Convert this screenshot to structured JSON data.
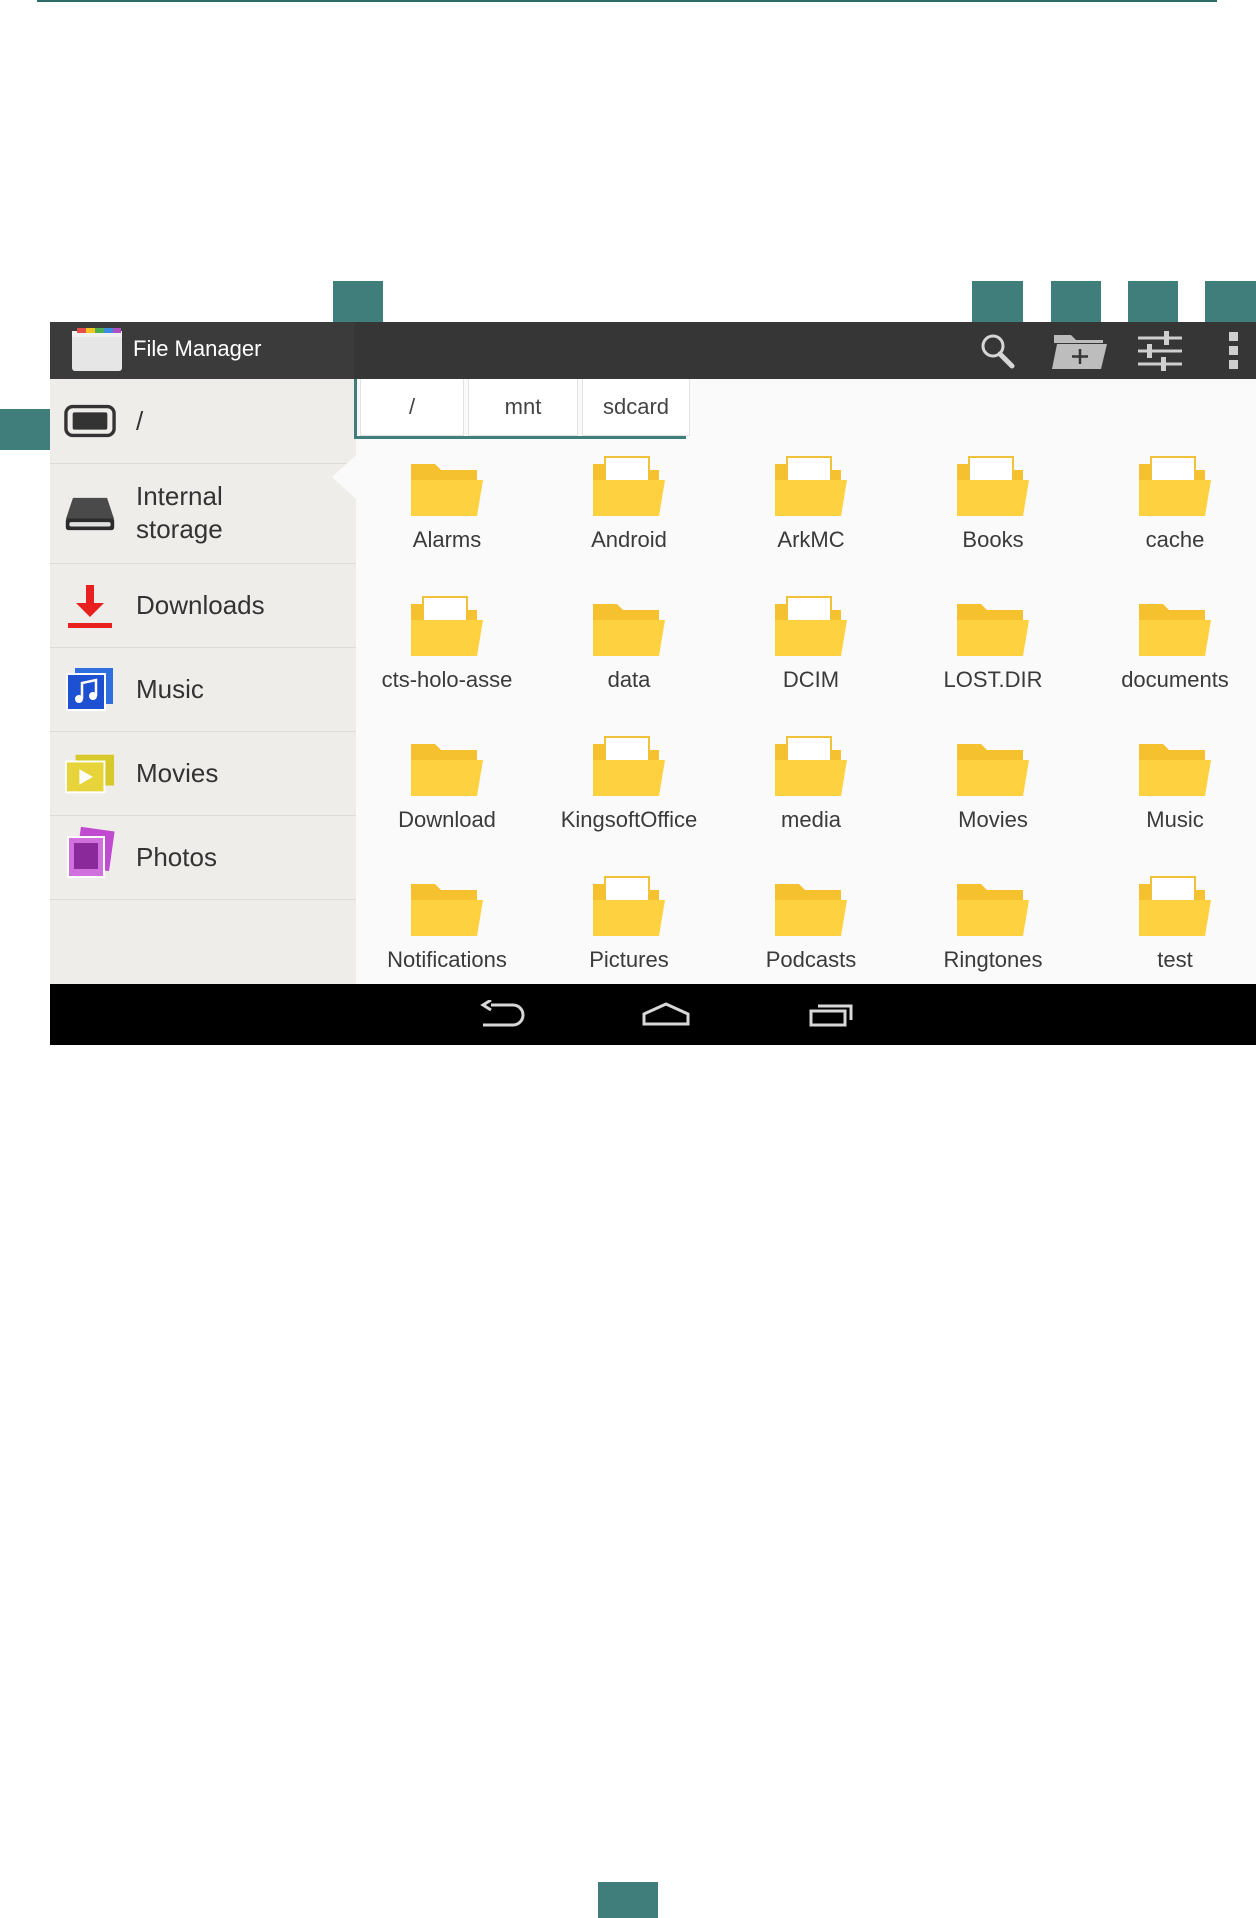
{
  "app": {
    "title": "File Manager",
    "colors": {
      "accent": "#3f7e7a",
      "folder": "#fdd13f",
      "actionbar": "#363636"
    }
  },
  "actionbar": {
    "actions": [
      {
        "icon": "search-icon"
      },
      {
        "icon": "new-folder-icon"
      },
      {
        "icon": "settings-sliders-icon"
      },
      {
        "icon": "overflow-menu-icon"
      }
    ]
  },
  "drawer": {
    "items": [
      {
        "label": "/",
        "icon": "root-device-icon"
      },
      {
        "label": "Internal storage",
        "icon": "storage-drive-icon"
      },
      {
        "label": "Downloads",
        "icon": "download-icon"
      },
      {
        "label": "Music",
        "icon": "music-icon"
      },
      {
        "label": "Movies",
        "icon": "movies-icon"
      },
      {
        "label": "Photos",
        "icon": "photos-icon"
      }
    ]
  },
  "breadcrumb": [
    "/",
    "mnt",
    "sdcard"
  ],
  "folders": [
    "Alarms",
    "Android",
    "ArkMC",
    "Books",
    "cache",
    "cts-holo-asse",
    "data",
    "DCIM",
    "LOST.DIR",
    "documents",
    "Download",
    "KingsoftOffice",
    "media",
    "Movies",
    "Music",
    "Notifications",
    "Pictures",
    "Podcasts",
    "Ringtones",
    "test"
  ],
  "navbar": {
    "buttons": [
      {
        "icon": "back-icon"
      },
      {
        "icon": "home-icon"
      },
      {
        "icon": "recents-icon"
      }
    ]
  }
}
